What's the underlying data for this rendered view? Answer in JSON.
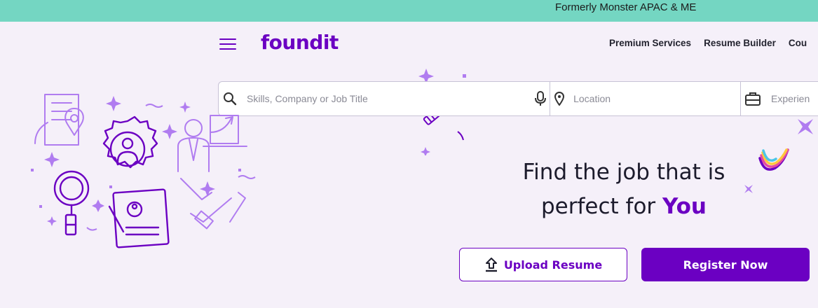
{
  "banner": {
    "text": "Formerly Monster APAC & ME"
  },
  "header": {
    "logo_text": "foundit",
    "nav": [
      {
        "label": "Premium Services"
      },
      {
        "label": "Resume Builder"
      },
      {
        "label": "Cou"
      }
    ]
  },
  "search": {
    "skills_placeholder": "Skills, Company or Job Title",
    "location_placeholder": "Location",
    "experience_placeholder": "Experien"
  },
  "hero": {
    "headline_line1": "Find the job that is",
    "headline_line2": "perfect for",
    "headline_highlight": "You"
  },
  "actions": {
    "upload_label": "Upload Resume",
    "register_label": "Register Now"
  },
  "colors": {
    "brand": "#6b00c2",
    "banner": "#74d6c2",
    "background": "#f5f0f9",
    "illustration": "#b07cf0"
  }
}
